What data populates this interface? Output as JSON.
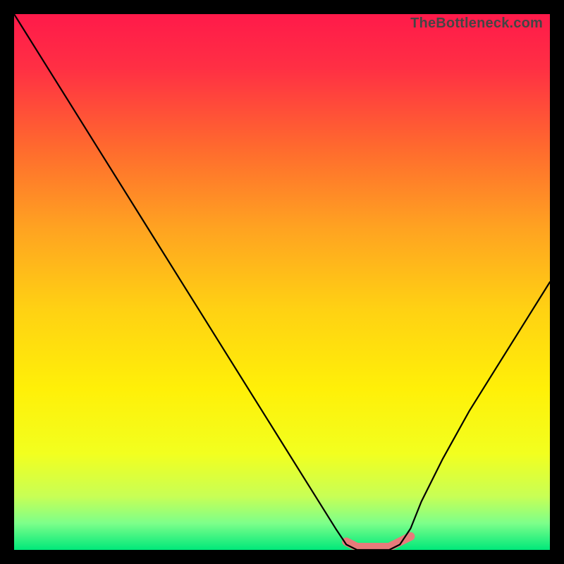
{
  "watermark": "TheBottleneck.com",
  "gradient": {
    "stops": [
      {
        "offset": 0.0,
        "color": "#ff1a4a"
      },
      {
        "offset": 0.1,
        "color": "#ff2f44"
      },
      {
        "offset": 0.25,
        "color": "#ff6a2e"
      },
      {
        "offset": 0.4,
        "color": "#ffa321"
      },
      {
        "offset": 0.55,
        "color": "#ffd113"
      },
      {
        "offset": 0.7,
        "color": "#fff008"
      },
      {
        "offset": 0.82,
        "color": "#f2ff1f"
      },
      {
        "offset": 0.9,
        "color": "#c8ff55"
      },
      {
        "offset": 0.95,
        "color": "#7dff8a"
      },
      {
        "offset": 1.0,
        "color": "#00e87a"
      }
    ]
  },
  "chart_data": {
    "type": "line",
    "title": "",
    "xlabel": "",
    "ylabel": "",
    "ylim": [
      0,
      100
    ],
    "x": [
      0,
      5,
      10,
      15,
      20,
      25,
      30,
      35,
      40,
      45,
      50,
      55,
      60,
      62,
      64,
      66,
      68,
      70,
      72,
      74,
      76,
      80,
      85,
      90,
      95,
      100
    ],
    "series": [
      {
        "name": "bottleneck-curve",
        "color": "#000000",
        "values": [
          100,
          92,
          84,
          76,
          68,
          60,
          52,
          44,
          36,
          28,
          20,
          12,
          4,
          1,
          0,
          0,
          0,
          0,
          1,
          4,
          9,
          17,
          26,
          34,
          42,
          50
        ]
      }
    ],
    "highlight": {
      "name": "optimal-zone",
      "color": "#e77b7b",
      "x_range": [
        61,
        75
      ],
      "y": 0
    }
  }
}
